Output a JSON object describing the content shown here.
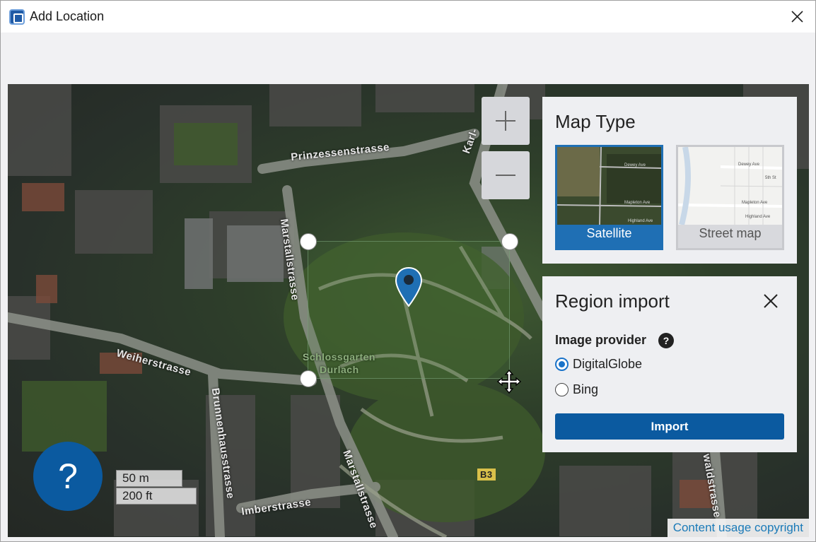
{
  "window": {
    "title": "Add Location"
  },
  "map": {
    "street_labels": [
      "Prinzessenstrasse",
      "Marstallstrasse",
      "Weiherstrasse",
      "Brunnenhausstrasse",
      "Marstallstrasse",
      "Imberstrasse",
      "Karl-",
      "Schlossgarten",
      "Durlach",
      "B3",
      "waldstrasse"
    ],
    "scale_metric": "50 m",
    "scale_imperial": "200 ft",
    "help_label": "?",
    "copyright": "Content usage copyright"
  },
  "map_type": {
    "title": "Map Type",
    "options": [
      {
        "label": "Satellite",
        "selected": true
      },
      {
        "label": "Street map",
        "selected": false
      }
    ],
    "street_thumb_labels": [
      "Dewey Ave",
      "Mapleton Ave",
      "Highland Ave",
      "5th St"
    ]
  },
  "region_import": {
    "title": "Region import",
    "provider_label": "Image provider",
    "provider_help": "?",
    "providers": [
      {
        "label": "DigitalGlobe",
        "checked": true
      },
      {
        "label": "Bing",
        "checked": false
      }
    ],
    "import_label": "Import"
  },
  "colors": {
    "accent": "#0b5aa0",
    "selected_card": "#1f6fb4",
    "link": "#1a7ab8"
  }
}
